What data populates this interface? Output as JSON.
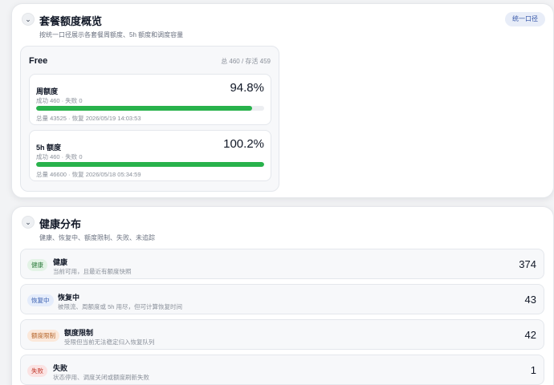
{
  "overview": {
    "title": "套餐额度概览",
    "subtitle": "按统一口径展示各套餐周额度、5h 额度和调度容量",
    "badge": "统一口径",
    "toggle_icon": "chevron-down-icon",
    "plan": {
      "name": "Free",
      "meta": "总 460 / 存活 459",
      "quotas": [
        {
          "label": "周额度",
          "stats": "成功 460 · 失败 0",
          "percent": "94.8%",
          "fill_ratio": 0.948,
          "footer": "总量 43525 · 恢复 2026/05/19 14:03:53"
        },
        {
          "label": "5h 额度",
          "stats": "成功 460 · 失败 0",
          "percent": "100.2%",
          "fill_ratio": 1.0,
          "footer": "总量 46600 · 恢复 2026/05/18 05:34:59"
        }
      ]
    }
  },
  "health": {
    "title": "健康分布",
    "subtitle": "健康、恢复中、额度限制、失败、未追踪",
    "toggle_icon": "chevron-down-icon",
    "rows": [
      {
        "tag": "健康",
        "title": "健康",
        "desc": "当前可用，且最近有额度快照",
        "count": "374",
        "tag_bg": "#e3f3e6",
        "tag_fg": "#2f7d3e"
      },
      {
        "tag": "恢复中",
        "title": "恢复中",
        "desc": "被限流、周额度或 5h 用尽，但可计算恢复时间",
        "count": "43",
        "tag_bg": "#e4ecfb",
        "tag_fg": "#3a5fb0"
      },
      {
        "tag": "额度限制",
        "title": "额度限制",
        "desc": "受限但当前无法稳定归入恢复队列",
        "count": "42",
        "tag_bg": "#fbe8da",
        "tag_fg": "#b5642a"
      },
      {
        "tag": "失败",
        "title": "失败",
        "desc": "状态停用、调度关闭或额度刷新失败",
        "count": "1",
        "tag_bg": "#fbe3e3",
        "tag_fg": "#c0392b"
      }
    ]
  }
}
